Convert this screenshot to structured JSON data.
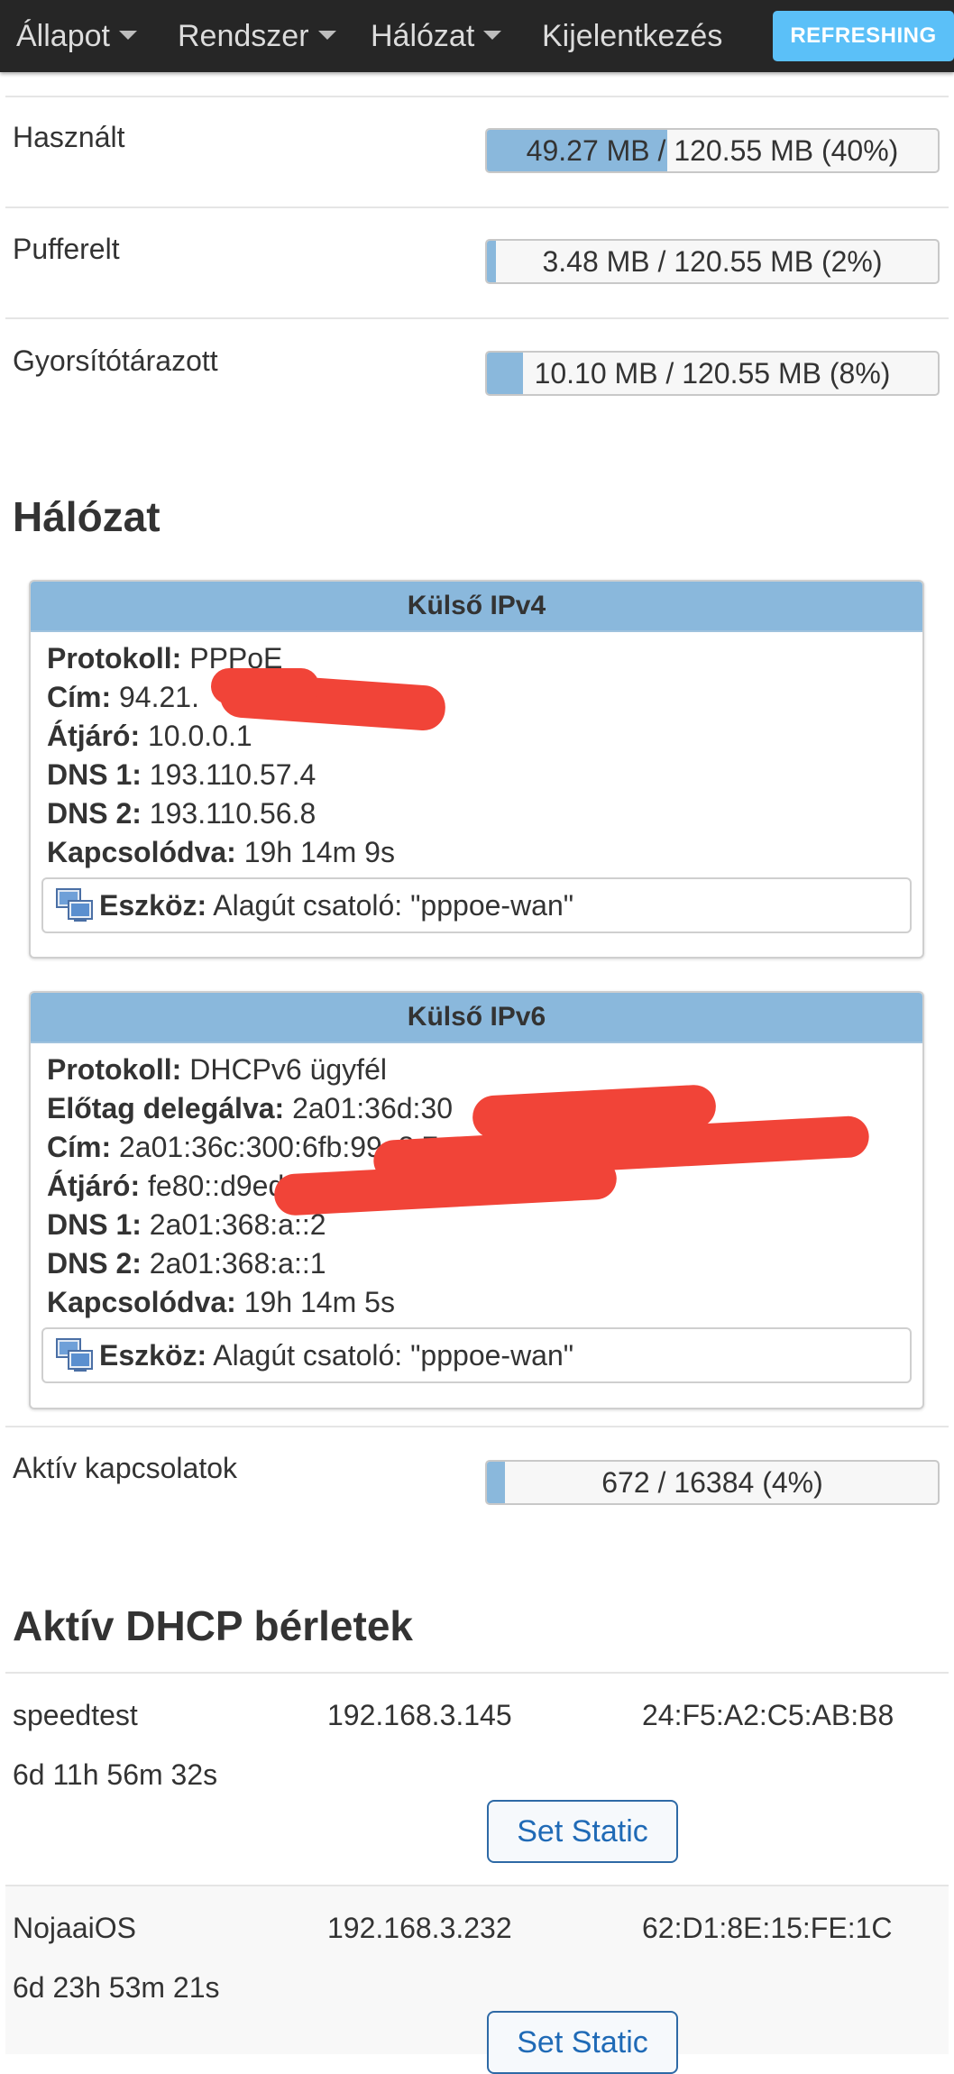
{
  "navbar": {
    "items": [
      {
        "label": "Állapot",
        "dropdown": true
      },
      {
        "label": "Rendszer",
        "dropdown": true
      },
      {
        "label": "Hálózat",
        "dropdown": true
      },
      {
        "label": "Kijelentkezés",
        "dropdown": false
      }
    ],
    "status_badge": "REFRESHING"
  },
  "memory": [
    {
      "label": "Használt",
      "value": "49.27 MB / 120.55 MB (40%)",
      "percent": 40
    },
    {
      "label": "Pufferelt",
      "value": "3.48 MB / 120.55 MB (2%)",
      "percent": 2
    },
    {
      "label": "Gyorsítótárazott",
      "value": "10.10 MB / 120.55 MB (8%)",
      "percent": 8
    }
  ],
  "network": {
    "title": "Hálózat",
    "ipv4": {
      "title": "Külső IPv4",
      "protocol_label": "Protokoll:",
      "protocol": "PPPoE",
      "address_label": "Cím:",
      "address": "94.21.",
      "gateway_label": "Átjáró:",
      "gateway": "10.0.0.1",
      "dns1_label": "DNS 1:",
      "dns1": "193.110.57.4",
      "dns2_label": "DNS 2:",
      "dns2": "193.110.56.8",
      "connected_label": "Kapcsolódva:",
      "connected": "19h 14m 9s",
      "device_label": "Eszköz:",
      "device": "Alagút csatoló: \"pppoe-wan\""
    },
    "ipv6": {
      "title": "Külső IPv6",
      "protocol_label": "Protokoll:",
      "protocol": "DHCPv6 ügyfél",
      "prefix_label": "Előtag delegálva:",
      "prefix": "2a01:36d:30",
      "address_label": "Cím:",
      "address": "2a01:36c:300:6fb:99e8:7a",
      "gateway_label": "Átjáró:",
      "gateway": "fe80::d9ed:e",
      "dns1_label": "DNS 1:",
      "dns1": "2a01:368:a::2",
      "dns2_label": "DNS 2:",
      "dns2": "2a01:368:a::1",
      "connected_label": "Kapcsolódva:",
      "connected": "19h 14m 5s",
      "device_label": "Eszköz:",
      "device": "Alagút csatoló: \"pppoe-wan\""
    },
    "active_connections": {
      "label": "Aktív kapcsolatok",
      "value": "672 / 16384 (4%)",
      "percent": 4
    }
  },
  "dhcp": {
    "title": "Aktív DHCP bérletek",
    "set_static_label": "Set Static",
    "leases": [
      {
        "hostname": "speedtest",
        "ip": "192.168.3.145",
        "mac": "24:F5:A2:C5:AB:B8",
        "expires": "6d 11h 56m 32s"
      },
      {
        "hostname": "NojaaiOS",
        "ip": "192.168.3.232",
        "mac": "62:D1:8E:15:FE:1C",
        "expires": "6d 23h 53m 21s"
      }
    ]
  },
  "colors": {
    "navbar_bg": "#262626",
    "accent_badge": "#5bc0f8",
    "bar_fill": "#8ab8dc",
    "panel_header": "#8ab8dc",
    "redaction": "#f14438",
    "button_text": "#1f6ab6"
  },
  "icons": [
    "caret-down-icon",
    "network-device-icon"
  ]
}
